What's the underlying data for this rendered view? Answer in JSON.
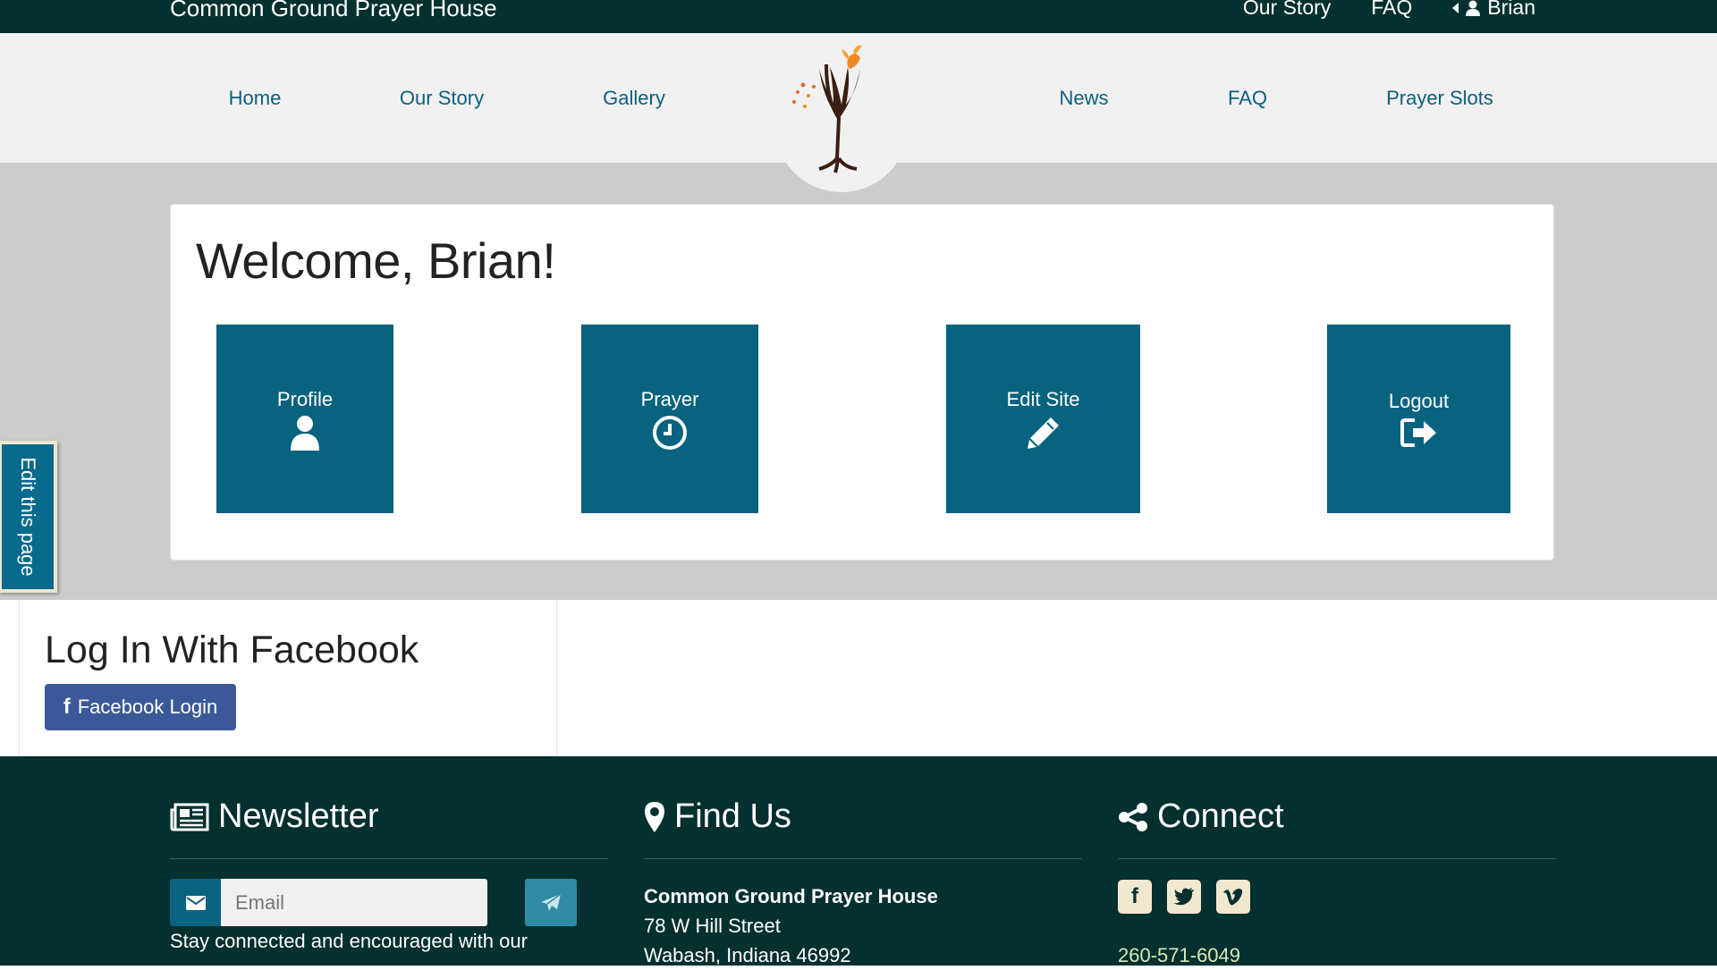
{
  "topbar": {
    "brand": "Common Ground Prayer House",
    "links": [
      "Our Story",
      "FAQ"
    ],
    "user": "Brian"
  },
  "nav": {
    "items": [
      "Home",
      "Our Story",
      "Gallery",
      "News",
      "FAQ",
      "Prayer Slots"
    ]
  },
  "welcome": "Welcome, Brian!",
  "tiles": [
    {
      "label": "Profile",
      "icon": "user-icon"
    },
    {
      "label": "Prayer",
      "icon": "clock-icon"
    },
    {
      "label": "Edit Site",
      "icon": "pencil-icon"
    },
    {
      "label": "Logout",
      "icon": "sign-out-icon"
    }
  ],
  "edit_tab": "Edit this page",
  "facebook": {
    "title": "Log In With Facebook",
    "button": "Facebook Login"
  },
  "footer": {
    "newsletter": {
      "title": "Newsletter",
      "placeholder": "Email",
      "description": "Stay connected and encouraged with our"
    },
    "find_us": {
      "title": "Find Us",
      "name": "Common Ground Prayer House",
      "street": "78 W Hill Street",
      "city": "Wabash, Indiana 46992"
    },
    "connect": {
      "title": "Connect",
      "phone": "260-571-6049",
      "social": [
        "facebook-icon",
        "twitter-icon",
        "vimeo-icon"
      ]
    }
  },
  "colors": {
    "dark_teal": "#04302f",
    "tile_blue": "#08637f",
    "nav_link": "#0a5f7f",
    "facebook_blue": "#3b5998"
  }
}
